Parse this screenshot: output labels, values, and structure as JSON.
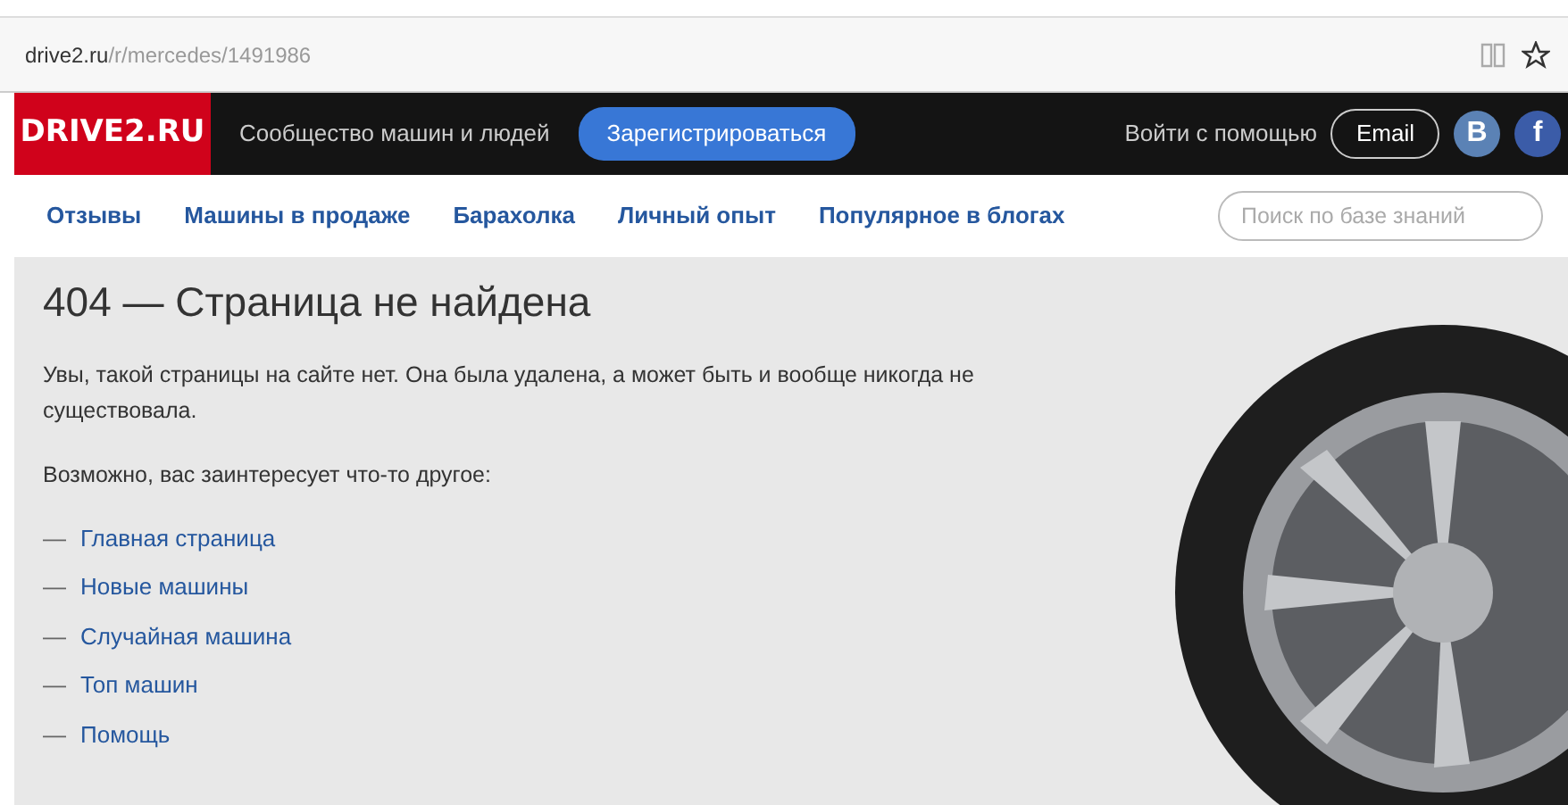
{
  "address_bar": {
    "host": "drive2.ru",
    "path": "/r/mercedes/1491986"
  },
  "header": {
    "logo": "DRIVE2.RU",
    "tagline": "Сообщество машин и людей",
    "register_button": "Зарегистрироваться",
    "login_label": "Войти с помощью",
    "email_button": "Email",
    "vk_button": "B",
    "facebook_button": "f"
  },
  "nav": {
    "items": [
      {
        "label": "Отзывы"
      },
      {
        "label": "Машины в продаже"
      },
      {
        "label": "Барахолка"
      },
      {
        "label": "Личный опыт"
      },
      {
        "label": "Популярное в блогах"
      }
    ],
    "search": {
      "placeholder": "Поиск по базе знаний"
    }
  },
  "content": {
    "title": "404 — Страница не найдена",
    "message": "Увы, такой страницы на сайте нет. Она была удалена, а может быть и вообще никогда не существовала.",
    "suggestion": "Возможно, вас заинтересует что-то другое:",
    "links": [
      {
        "bullet": "—",
        "label": "Главная страница"
      },
      {
        "bullet": "—",
        "label": "Новые машины"
      },
      {
        "bullet": "—",
        "label": "Случайная машина"
      },
      {
        "bullet": "—",
        "label": "Топ машин"
      },
      {
        "bullet": "—",
        "label": "Помощь"
      }
    ]
  }
}
